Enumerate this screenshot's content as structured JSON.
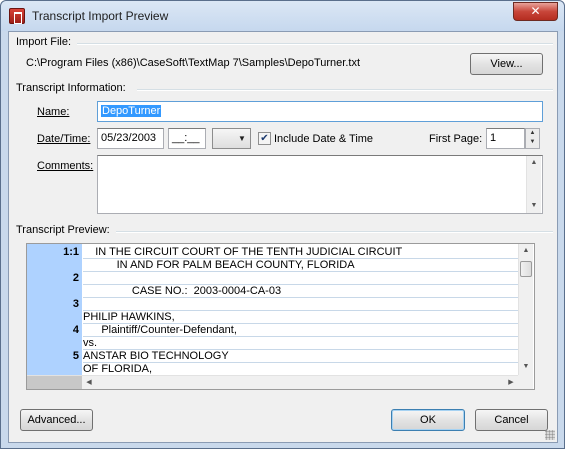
{
  "window": {
    "title": "Transcript Import Preview",
    "close_glyph": "✕"
  },
  "import_file": {
    "group_label": "Import File:",
    "path": "C:\\Program Files (x86)\\CaseSoft\\TextMap 7\\Samples\\DepoTurner.txt",
    "view_button": "View..."
  },
  "transcript_info": {
    "group_label": "Transcript Information:",
    "name_label": "Name:",
    "name_value": "DepoTurner",
    "datetime_label": "Date/Time:",
    "date_value": "05/23/2003",
    "time_value": "__:__",
    "include_date_time_label": "Include Date & Time",
    "include_date_time_checked": true,
    "first_page_label": "First Page:",
    "first_page_value": "1",
    "comments_label": "Comments:",
    "comments_value": ""
  },
  "transcript_preview": {
    "group_label": "Transcript Preview:",
    "rows": [
      {
        "num": "1:1",
        "text": "    IN THE CIRCUIT COURT OF THE TENTH JUDICIAL CIRCUIT"
      },
      {
        "num": "",
        "text": "           IN AND FOR PALM BEACH COUNTY, FLORIDA"
      },
      {
        "num": "2",
        "text": ""
      },
      {
        "num": "",
        "text": "                CASE NO.:  2003-0004-CA-03"
      },
      {
        "num": "3",
        "text": ""
      },
      {
        "num": "",
        "text": "PHILIP HAWKINS,"
      },
      {
        "num": "4",
        "text": "      Plaintiff/Counter-Defendant,"
      },
      {
        "num": "",
        "text": "vs."
      },
      {
        "num": "5",
        "text": "ANSTAR BIO TECHNOLOGY"
      },
      {
        "num": "",
        "text": "OF FLORIDA,"
      }
    ]
  },
  "footer": {
    "advanced_button": "Advanced...",
    "ok_button": "OK",
    "cancel_button": "Cancel"
  },
  "colors": {
    "selection": "#3399ff",
    "gutter": "#aed2ff",
    "frame": "#c9d9ec"
  }
}
